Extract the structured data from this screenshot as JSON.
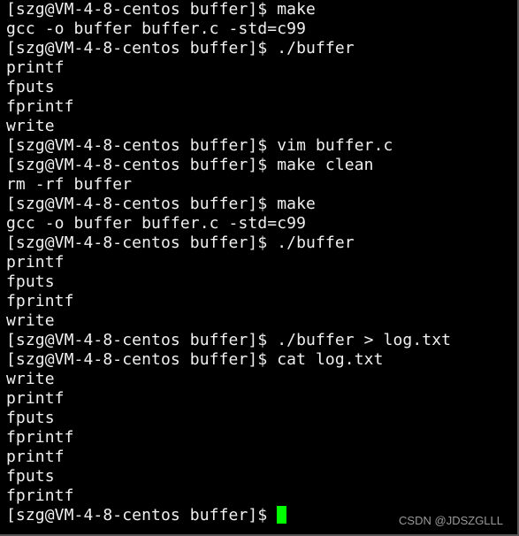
{
  "terminal": {
    "lines": [
      "[szg@VM-4-8-centos buffer]$ make",
      "gcc -o buffer buffer.c -std=c99",
      "[szg@VM-4-8-centos buffer]$ ./buffer",
      "printf",
      "fputs",
      "fprintf",
      "write",
      "[szg@VM-4-8-centos buffer]$ vim buffer.c",
      "[szg@VM-4-8-centos buffer]$ make clean",
      "rm -rf buffer",
      "[szg@VM-4-8-centos buffer]$ make",
      "gcc -o buffer buffer.c -std=c99",
      "[szg@VM-4-8-centos buffer]$ ./buffer",
      "printf",
      "fputs",
      "fprintf",
      "write",
      "[szg@VM-4-8-centos buffer]$ ./buffer > log.txt",
      "[szg@VM-4-8-centos buffer]$ cat log.txt",
      "write",
      "printf",
      "fputs",
      "fprintf",
      "printf",
      "fputs",
      "fprintf"
    ],
    "prompt": "[szg@VM-4-8-centos buffer]$ ",
    "cursor_color": "#00ff00",
    "text_color": "#f0f0f0",
    "background": "#000000"
  },
  "watermark": "CSDN @JDSZGLLL"
}
